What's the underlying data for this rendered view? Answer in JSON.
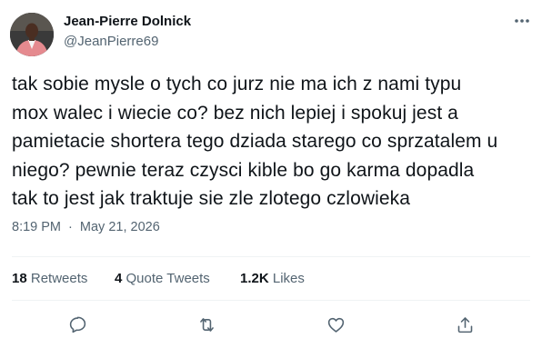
{
  "author": {
    "display_name": "Jean-Pierre Dolnick",
    "handle": "@JeanPierre69"
  },
  "tweet": {
    "text": "tak sobie mysle o tych co jurz nie ma ich z nami typu\nmox walec i wiecie co? bez nich lepiej i spokuj jest a\npamietacie shortera tego dziada starego co sprzatalem u\nniego? pewnie teraz czysci kible bo go karma dopadla\ntak to jest jak traktuje sie zle zlotego czlowieka",
    "time": "8:19 PM",
    "separator": "·",
    "date": "May 21, 2026"
  },
  "stats": {
    "retweets_count": "18",
    "retweets_label": "Retweets",
    "quotes_count": "4",
    "quotes_label": "Quote Tweets",
    "likes_count": "1.2K",
    "likes_label": "Likes"
  },
  "icons": {
    "more": "more-icon",
    "reply": "reply-icon",
    "retweet": "retweet-icon",
    "like": "heart-icon",
    "share": "share-icon"
  },
  "colors": {
    "text": "#0f1419",
    "secondary": "#536471",
    "divider": "#eff3f4"
  }
}
